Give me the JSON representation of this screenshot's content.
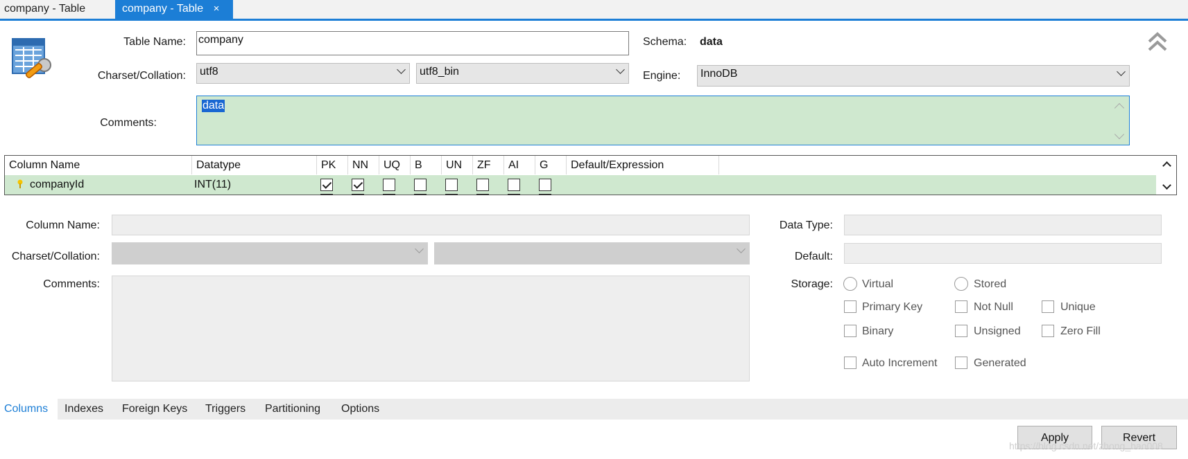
{
  "tabs": [
    {
      "label": "company - Table"
    },
    {
      "label": "company - Table",
      "close": "×"
    }
  ],
  "table": {
    "name_label": "Table Name:",
    "name_value": "company",
    "schema_label": "Schema:",
    "schema_value": "data",
    "charset_label": "Charset/Collation:",
    "charset_value": "utf8",
    "collation_value": "utf8_bin",
    "engine_label": "Engine:",
    "engine_value": "InnoDB",
    "comments_label": "Comments:",
    "comments_value": "data"
  },
  "grid": {
    "headers": [
      "Column Name",
      "Datatype",
      "PK",
      "NN",
      "UQ",
      "B",
      "UN",
      "ZF",
      "AI",
      "G",
      "Default/Expression"
    ],
    "rows": [
      {
        "name": "companyId",
        "datatype": "INT(11)",
        "pk": true,
        "nn": true,
        "uq": false,
        "b": false,
        "un": false,
        "zf": false,
        "ai": false,
        "g": false,
        "default": ""
      }
    ]
  },
  "detail": {
    "column_name_label": "Column Name:",
    "charset_label": "Charset/Collation:",
    "comments_label": "Comments:",
    "data_type_label": "Data Type:",
    "default_label": "Default:",
    "storage_label": "Storage:",
    "options": {
      "virtual": "Virtual",
      "stored": "Stored",
      "primary_key": "Primary Key",
      "not_null": "Not Null",
      "unique": "Unique",
      "binary": "Binary",
      "unsigned": "Unsigned",
      "zero_fill": "Zero Fill",
      "auto_increment": "Auto Increment",
      "generated": "Generated"
    }
  },
  "bottom_tabs": [
    "Columns",
    "Indexes",
    "Foreign Keys",
    "Triggers",
    "Partitioning",
    "Options"
  ],
  "buttons": {
    "apply": "Apply",
    "revert": "Revert"
  },
  "watermark": "https://blog.csdn.net/zhong_bao008",
  "colors": {
    "accent": "#1c7ed6",
    "selection_bg": "#cfe8cf"
  }
}
